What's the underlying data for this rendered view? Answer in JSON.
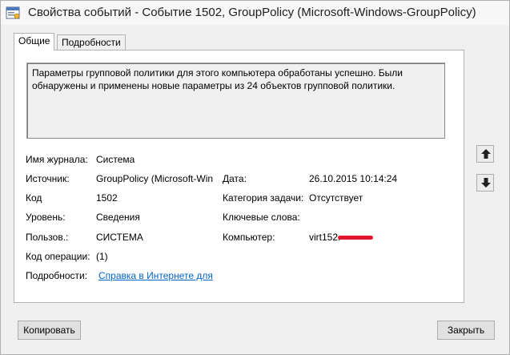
{
  "window": {
    "title": "Свойства событий - Событие 1502, GroupPolicy (Microsoft-Windows-GroupPolicy)"
  },
  "tabs": [
    {
      "label": "Общие"
    },
    {
      "label": "Подробности"
    }
  ],
  "general": {
    "description": "Параметры групповой политики для этого компьютера обработаны успешно. Были обнаружены и применены новые параметры из 24 объектов групповой политики.",
    "log_name_label": "Имя журнала:",
    "log_name_value": "Система",
    "source_label": "Источник:",
    "source_value": "GroupPolicy (Microsoft-Win",
    "date_label": "Дата:",
    "date_value": "26.10.2015 10:14:24",
    "code_label": "Код",
    "code_value": "1502",
    "task_category_label": "Категория задачи:",
    "task_category_value": "Отсутствует",
    "level_label": "Уровень:",
    "level_value": "Сведения",
    "keywords_label": "Ключевые слова:",
    "keywords_value": "",
    "user_label": "Пользов.:",
    "user_value": "СИСТЕМА",
    "computer_label": "Компьютер:",
    "computer_value": "virt152.",
    "opcode_label": "Код операции:",
    "opcode_value": "(1)",
    "details_label": "Подробности:",
    "details_link": "Справка в Интернете для"
  },
  "buttons": {
    "copy": "Копировать",
    "close": "Закрыть"
  },
  "icons": {
    "title": "event-properties-icon",
    "up": "arrow-up-icon",
    "down": "arrow-down-icon"
  },
  "colors": {
    "link": "#0066cc",
    "redaction": "#e3162f"
  }
}
